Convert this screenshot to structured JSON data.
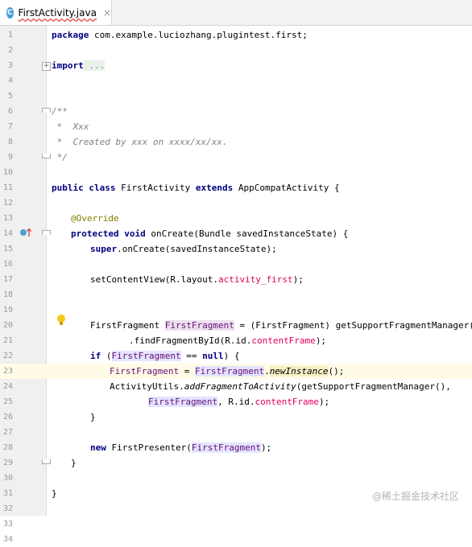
{
  "tab": {
    "title": "FirstActivity.java",
    "icon": "C",
    "close": "×"
  },
  "lines": [
    {
      "n": "1"
    },
    {
      "n": "2"
    },
    {
      "n": "3"
    },
    {
      "n": "4"
    },
    {
      "n": "5"
    },
    {
      "n": "6"
    },
    {
      "n": "7"
    },
    {
      "n": "8"
    },
    {
      "n": "9"
    },
    {
      "n": "10"
    },
    {
      "n": "11"
    },
    {
      "n": "12"
    },
    {
      "n": "13"
    },
    {
      "n": "14"
    },
    {
      "n": "15"
    },
    {
      "n": "16"
    },
    {
      "n": "17"
    },
    {
      "n": "18"
    },
    {
      "n": "19"
    },
    {
      "n": "20"
    },
    {
      "n": "21"
    },
    {
      "n": "22"
    },
    {
      "n": "23"
    },
    {
      "n": "24"
    },
    {
      "n": "25"
    },
    {
      "n": "26"
    },
    {
      "n": "27"
    },
    {
      "n": "28"
    },
    {
      "n": "29"
    },
    {
      "n": "30"
    },
    {
      "n": "31"
    },
    {
      "n": "32"
    },
    {
      "n": "33"
    },
    {
      "n": "34"
    }
  ],
  "code": {
    "l1_kw": "package",
    "l1_rest": " com.example.luciozhang.plugintest.first;",
    "l3_kw": "import",
    "l3_rest": " ...",
    "l9": "/**",
    "l10": " *  Xxx",
    "l11": " *  Created by xxx on xxxx/xx/xx.",
    "l12": " */",
    "l14_kw1": "public",
    "l14_kw2": "class",
    "l14_name": "FirstActivity",
    "l14_kw3": "extends",
    "l14_rest": "AppCompatActivity {",
    "l16": "@Override",
    "l17_kw1": "protected",
    "l17_kw2": "void",
    "l17_rest": " onCreate(Bundle savedInstanceState) {",
    "l18_kw": "super",
    "l18_rest": ".onCreate(savedInstanceState);",
    "l20_a": "setContentView(R.layout.",
    "l20_b": "activity_first",
    "l20_c": ");",
    "l23_a": "FirstFragment ",
    "l23_b": "FirstFragment",
    "l23_c": " = (FirstFragment) getSupportFragmentManager()",
    "l24_a": ".findFragmentById(R.id.",
    "l24_b": "contentFrame",
    "l24_c": ");",
    "l25_kw": "if",
    "l25_a": " (",
    "l25_b": "FirstFragment",
    "l25_c": " == ",
    "l25_kw2": "null",
    "l25_d": ") {",
    "l26_a": "FirstFragment",
    "l26_b": " = ",
    "l26_c": "FirstFragment",
    "l26_d": ".",
    "l26_e": "newInstance",
    "l26_f": "();",
    "l27_a": "ActivityUtils.",
    "l27_b": "addFragmentToActivity",
    "l27_c": "(getSupportFragmentManager(),",
    "l28_a": "FirstFragment",
    "l28_b": ", R.id.",
    "l28_c": "contentFrame",
    "l28_d": ");",
    "l29": "}",
    "l31_kw": "new",
    "l31_a": " FirstPresenter(",
    "l31_b": "FirstFragment",
    "l31_c": ");",
    "l32": "}",
    "l34": "}"
  },
  "watermark": "@稀土掘金技术社区"
}
